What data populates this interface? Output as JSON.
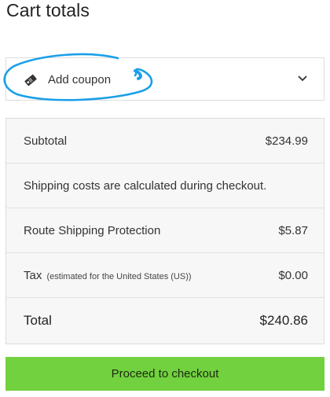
{
  "heading": "Cart totals",
  "coupon": {
    "label": "Add coupon",
    "icon": "coupon-tag-icon",
    "toggle_icon": "chevron-down-icon"
  },
  "rows": [
    {
      "label": "Subtotal",
      "value": "$234.99"
    },
    {
      "label": "Shipping costs are calculated during checkout."
    },
    {
      "label": "Route Shipping Protection",
      "value": "$5.87"
    },
    {
      "label": "Tax",
      "note": "(estimated for the United States (US))",
      "value": "$0.00"
    },
    {
      "label": "Total",
      "value": "$240.86"
    }
  ],
  "checkout_button": "Proceed to checkout",
  "colors": {
    "accent_green": "#72d13e",
    "annotation_blue": "#1aa0e8",
    "panel_bg": "#f7f7f7"
  }
}
